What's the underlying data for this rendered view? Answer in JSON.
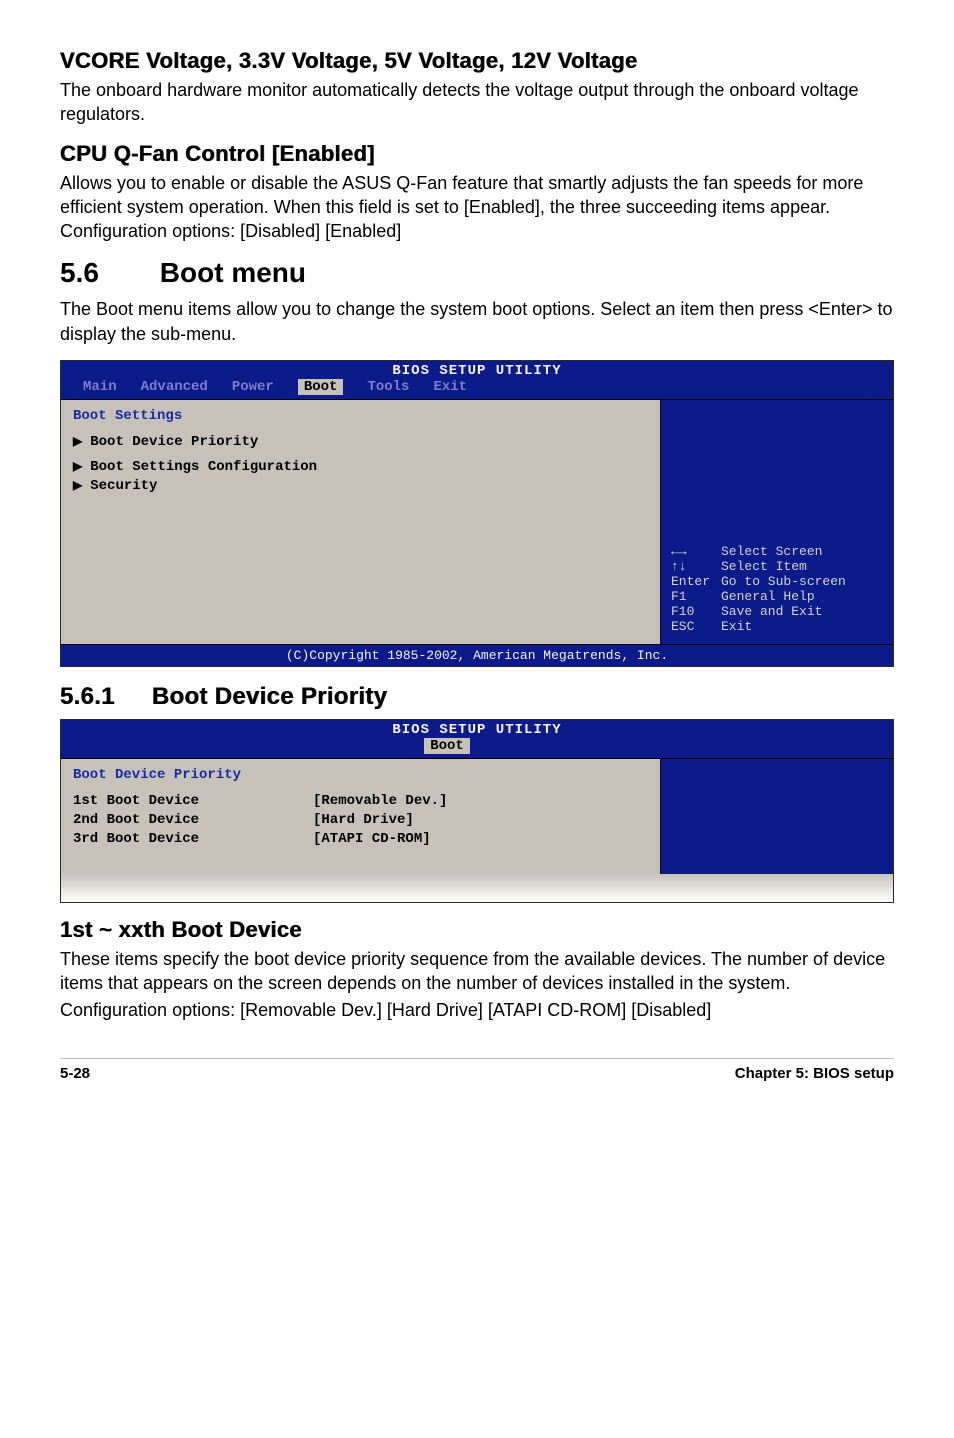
{
  "sec1": {
    "head": "VCORE Voltage, 3.3V Voltage, 5V Voltage, 12V Voltage",
    "body": "The onboard hardware monitor automatically detects the voltage output through the onboard voltage regulators."
  },
  "sec2": {
    "head": "CPU Q-Fan Control [Enabled]",
    "body": "Allows you to enable or disable the ASUS Q-Fan feature that smartly adjusts the fan speeds for more efficient system operation. When this field is set to [Enabled], the three succeeding items appear. Configuration options: [Disabled] [Enabled]"
  },
  "sec3": {
    "num": "5.6",
    "title": "Boot menu",
    "body": "The Boot menu items allow you to change the system boot options. Select an item then press <Enter> to display the sub-menu."
  },
  "bios1": {
    "title": "BIOS SETUP UTILITY",
    "tabs": {
      "main": "Main",
      "advanced": "Advanced",
      "power": "Power",
      "boot": "Boot",
      "tools": "Tools",
      "exit": "Exit"
    },
    "heading": "Boot Settings",
    "items": {
      "i1": "Boot Device Priority",
      "i2": "Boot Settings Configuration",
      "i3": "Security"
    },
    "legend": {
      "l1k": "←→",
      "l1v": "Select Screen",
      "l2k": "↑↓",
      "l2v": "Select Item",
      "l3k": "Enter",
      "l3v": "Go to Sub-screen",
      "l4k": "F1",
      "l4v": "General Help",
      "l5k": "F10",
      "l5v": "Save and Exit",
      "l6k": "ESC",
      "l6v": "Exit"
    },
    "footer": "(C)Copyright 1985-2002, American Megatrends, Inc."
  },
  "sec4": {
    "num": "5.6.1",
    "title": "Boot Device Priority"
  },
  "bios2": {
    "title": "BIOS SETUP UTILITY",
    "tab": "Boot",
    "heading": "Boot Device Priority",
    "rows": {
      "r1l": "1st Boot Device",
      "r1v": "[Removable Dev.]",
      "r2l": "2nd Boot Device",
      "r2v": "[Hard Drive]",
      "r3l": "3rd Boot Device",
      "r3v": "[ATAPI CD-ROM]"
    }
  },
  "sec5": {
    "head": "1st ~ xxth Boot Device",
    "body1": "These items specify the boot device priority sequence from the available devices. The number of device items that appears on the screen depends on the number of devices installed in the system.",
    "body2": "Configuration options: [Removable Dev.] [Hard Drive] [ATAPI CD-ROM] [Disabled]"
  },
  "footer": {
    "left": "5-28",
    "right": "Chapter 5: BIOS setup"
  }
}
